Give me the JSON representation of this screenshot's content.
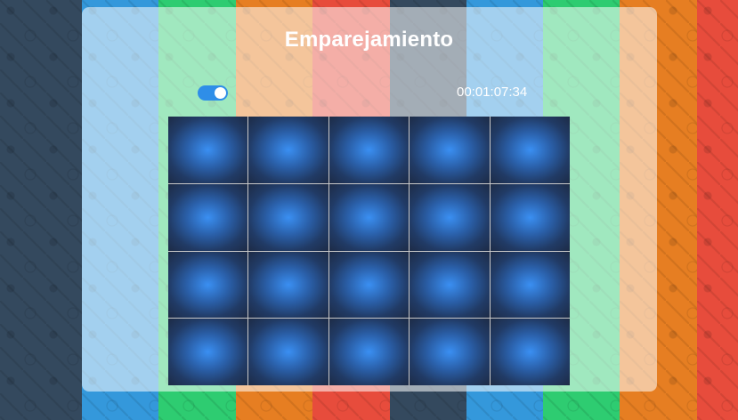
{
  "background": {
    "stripe_colors": [
      "#34495e",
      "#3498db",
      "#2ecc71",
      "#e67e22",
      "#e74c3c",
      "#34495e",
      "#3498db",
      "#2ecc71",
      "#e67e22",
      "#e74c3c"
    ]
  },
  "header": {
    "title": "Emparejamiento"
  },
  "controls": {
    "toggle_on": true,
    "timer": "00:01:07:34"
  },
  "board": {
    "rows": 4,
    "columns": 5,
    "card_state": "face-down",
    "card_back_colors": [
      "#3a8ff2",
      "#1d2b46"
    ]
  }
}
